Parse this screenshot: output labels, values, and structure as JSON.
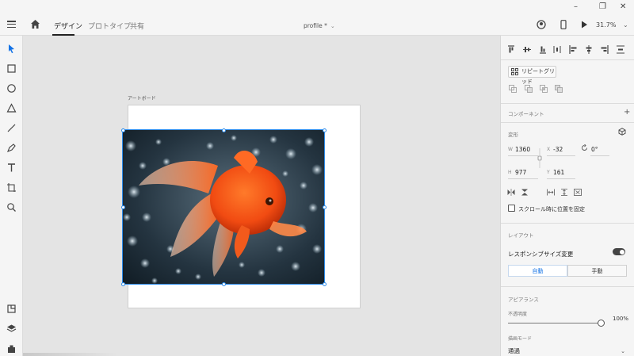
{
  "topbar": {
    "tabs": [
      {
        "label": "デザイン"
      },
      {
        "label": "プロトタイプ"
      },
      {
        "label": "共有"
      }
    ],
    "document_title": "profile *",
    "zoom": "31.7%"
  },
  "canvas": {
    "artboard_label": "アートボード"
  },
  "panel": {
    "repeat_grid_label": "リピートグリッド",
    "components_title": "コンポーネント",
    "transform_title": "変形",
    "fields": {
      "w_label": "W",
      "w_value": "1360",
      "x_label": "X",
      "x_value": "-32",
      "rot_value": "0°",
      "h_label": "H",
      "h_value": "977",
      "y_label": "Y",
      "y_value": "161"
    },
    "fix_scroll_label": "スクロール時に位置を固定",
    "layout_title": "レイアウト",
    "responsive_label": "レスポンシブサイズ変更",
    "auto_label": "自動",
    "manual_label": "手動",
    "appearance_title": "アピアランス",
    "opacity_label": "不透明度",
    "opacity_value": "100%",
    "blend_label": "描画モード",
    "blend_value": "通過"
  },
  "colors": {
    "accent": "#2d8ceb",
    "auto_text": "#1473e6"
  }
}
